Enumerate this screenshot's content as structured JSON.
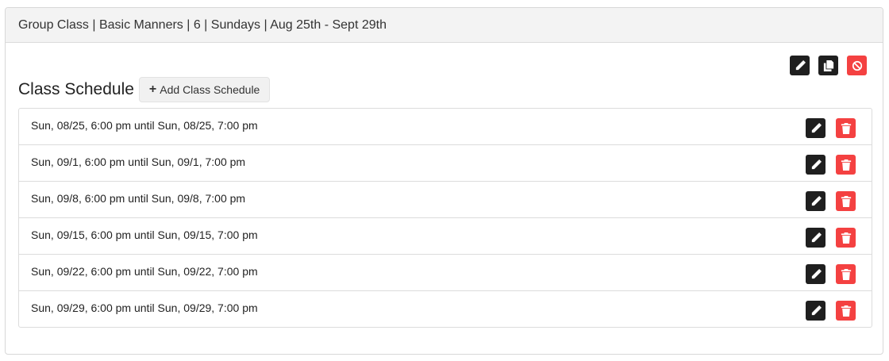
{
  "header": {
    "title": "Group Class | Basic Manners | 6 | Sundays | Aug 25th - Sept 29th"
  },
  "top_actions": [
    {
      "name": "edit-class-button",
      "icon": "pencil-icon",
      "color": "#1f1f1f"
    },
    {
      "name": "copy-class-button",
      "icon": "copy-icon",
      "color": "#1f1f1f"
    },
    {
      "name": "cancel-class-button",
      "icon": "ban-icon",
      "color": "#f44141"
    }
  ],
  "schedule": {
    "title": "Class Schedule",
    "add_label": "Add Class Schedule",
    "rows": [
      {
        "text": "Sun, 08/25, 6:00 pm until Sun, 08/25, 7:00 pm"
      },
      {
        "text": "Sun, 09/1, 6:00 pm until Sun, 09/1, 7:00 pm"
      },
      {
        "text": "Sun, 09/8, 6:00 pm until Sun, 09/8, 7:00 pm"
      },
      {
        "text": "Sun, 09/15, 6:00 pm until Sun, 09/15, 7:00 pm"
      },
      {
        "text": "Sun, 09/22, 6:00 pm until Sun, 09/22, 7:00 pm"
      },
      {
        "text": "Sun, 09/29, 6:00 pm until Sun, 09/29, 7:00 pm"
      }
    ]
  },
  "colors": {
    "dark_button": "#1f1f1f",
    "danger_button": "#f44141",
    "header_bg": "#f3f3f3"
  }
}
